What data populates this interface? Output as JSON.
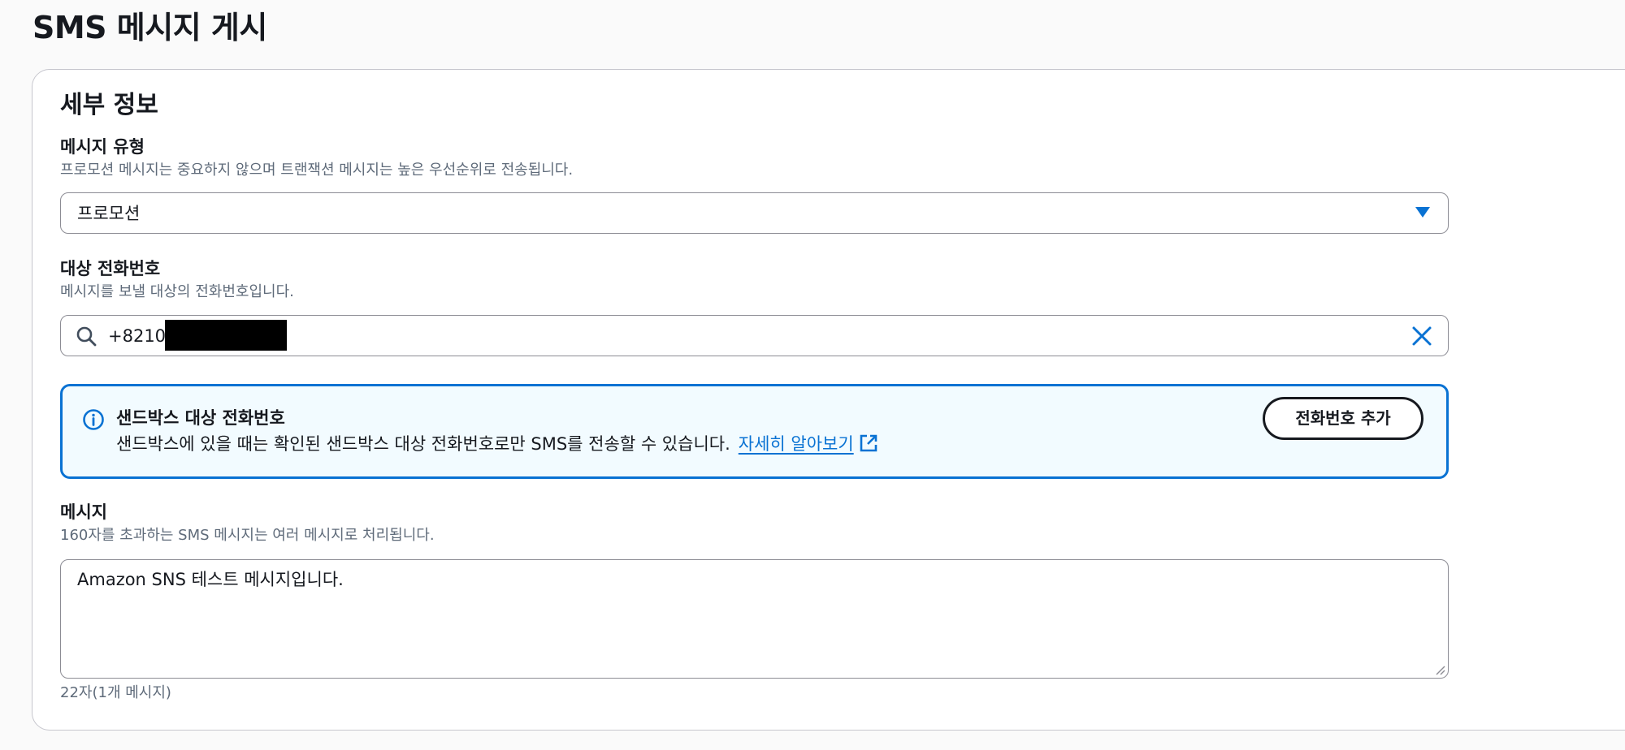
{
  "page": {
    "title": "SMS 메시지 게시"
  },
  "details": {
    "section_title": "세부 정보",
    "message_type": {
      "label": "메시지 유형",
      "description": "프로모션 메시지는 중요하지 않으며 트랜잭션 메시지는 높은 우선순위로 전송됩니다.",
      "selected": "프로모션",
      "icon": "caret-down-icon"
    },
    "phone": {
      "label": "대상 전화번호",
      "description": "메시지를 보낼 대상의 전화번호입니다.",
      "value": "+8210",
      "icons": [
        "search-icon",
        "clear-icon"
      ]
    },
    "sandbox_alert": {
      "title": "샌드박스 대상 전화번호",
      "body": "샌드박스에 있을 때는 확인된 샌드박스 대상 전화번호로만 SMS를 전송할 수 있습니다.",
      "link_text": "자세히 알아보기",
      "button_label": "전화번호 추가",
      "icons": [
        "info-icon",
        "external-link-icon"
      ]
    },
    "message": {
      "label": "메시지",
      "description": "160자를 초과하는 SMS 메시지는 여러 메시지로 처리됩니다.",
      "value": "Amazon SNS 테스트 메시지입니다.",
      "char_count": "22자(1개 메시지)"
    }
  },
  "colors": {
    "accent": "#0972d3",
    "alert_bg": "#f2fbff",
    "text": "#16191f",
    "muted": "#5f6b7a",
    "border": "#8c8c94"
  }
}
